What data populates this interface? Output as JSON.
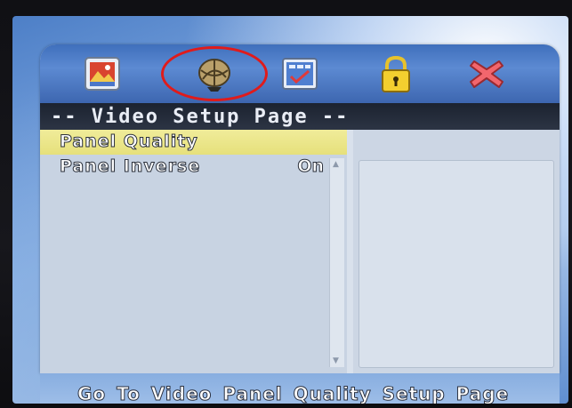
{
  "tabs": [
    {
      "name": "general-setup",
      "icon": "general-setup-icon"
    },
    {
      "name": "video-setup",
      "icon": "video-setup-icon",
      "selected": true
    },
    {
      "name": "preference",
      "icon": "preference-icon"
    },
    {
      "name": "password",
      "icon": "lock-icon"
    },
    {
      "name": "exit",
      "icon": "exit-icon"
    }
  ],
  "page": {
    "title": "-- Video Setup Page --"
  },
  "menu": {
    "items": [
      {
        "label": "Panel Quality",
        "value": "",
        "selected": true
      },
      {
        "label": "Panel Inverse",
        "value": "On",
        "selected": false
      }
    ]
  },
  "status": {
    "text": "Go To Video Panel Quality Setup Page"
  },
  "colors": {
    "selection_highlight": "#e6e07b",
    "selection_ring": "#e01b1b",
    "title_bar": "#1c2330",
    "icon_bar": "#4a78c2"
  }
}
